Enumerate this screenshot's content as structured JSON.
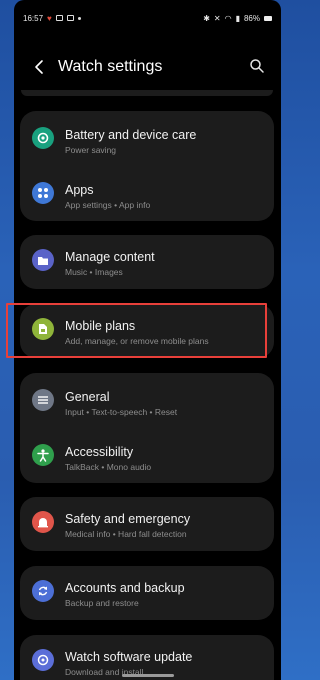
{
  "status": {
    "time": "16:57",
    "battery": "86%"
  },
  "header": {
    "title": "Watch settings"
  },
  "items": [
    {
      "title": "Battery and device care",
      "subtitle": "Power saving",
      "icon": "battery-care-icon",
      "color": "#19a17f"
    },
    {
      "title": "Apps",
      "subtitle": "App settings • App info",
      "icon": "apps-grid-icon",
      "color": "#3f78d6"
    },
    {
      "title": "Manage content",
      "subtitle": "Music • Images",
      "icon": "folder-icon",
      "color": "#5a63c8"
    },
    {
      "title": "Mobile plans",
      "subtitle": "Add, manage, or remove mobile plans",
      "icon": "sim-card-icon",
      "color": "#8fb43a"
    },
    {
      "title": "General",
      "subtitle": "Input • Text-to-speech • Reset",
      "icon": "sliders-icon",
      "color": "#6f7786"
    },
    {
      "title": "Accessibility",
      "subtitle": "TalkBack • Mono audio",
      "icon": "accessibility-icon",
      "color": "#2f9f4c"
    },
    {
      "title": "Safety and emergency",
      "subtitle": "Medical info • Hard fall detection",
      "icon": "emergency-icon",
      "color": "#e0554a"
    },
    {
      "title": "Accounts and backup",
      "subtitle": "Backup and restore",
      "icon": "sync-icon",
      "color": "#4c6fd6"
    },
    {
      "title": "Watch software update",
      "subtitle": "Download and install",
      "icon": "update-icon",
      "color": "#5b6ed8"
    }
  ]
}
